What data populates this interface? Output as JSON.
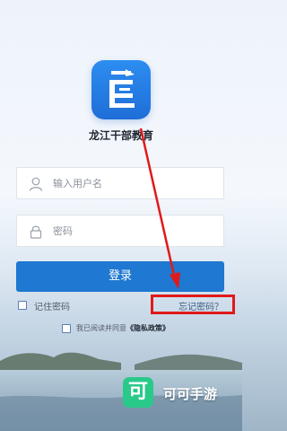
{
  "app": {
    "name": "龙江干部教育"
  },
  "login_form": {
    "username_placeholder": "输入用户名",
    "password_placeholder": "密码",
    "login_label": "登录",
    "remember_label": "记住密码",
    "forgot_label": "忘记密码？"
  },
  "agreement": {
    "prefix": "我已阅读并同意",
    "policy_label": "《隐私政策》"
  },
  "watermark": {
    "badge": "可",
    "text": "可可手游"
  },
  "colors": {
    "primary": "#1f78d1",
    "highlight": "#e01a1a",
    "watermark": "#29c98a"
  }
}
